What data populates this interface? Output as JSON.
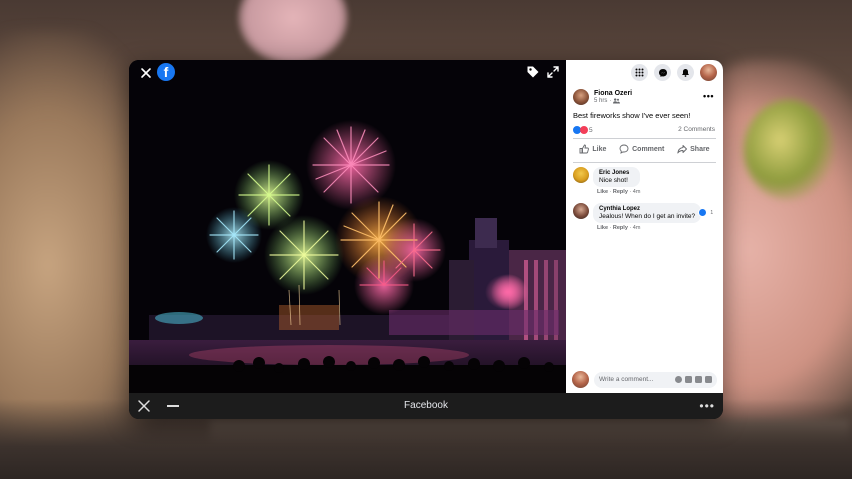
{
  "app": {
    "title": "Facebook"
  },
  "post": {
    "author": "Fiona Ozeri",
    "time": "5 hrs",
    "text": "Best fireworks show I've ever seen!",
    "reaction_count": "5",
    "comments_count": "2 Comments"
  },
  "actions": {
    "like": "Like",
    "comment": "Comment",
    "share": "Share"
  },
  "comments": [
    {
      "name": "Eric Jones",
      "text": "Nice shot!",
      "like": "Like",
      "reply": "Reply",
      "time": "4m"
    },
    {
      "name": "Cynthia Lopez",
      "text": "Jealous! When do I get an invite?",
      "like": "Like",
      "reply": "Reply",
      "time": "4m",
      "reaction_count": "1"
    }
  ],
  "composer": {
    "placeholder": "Write a comment..."
  },
  "colors": {
    "brand": "#1877f2",
    "love": "#f33e58"
  }
}
